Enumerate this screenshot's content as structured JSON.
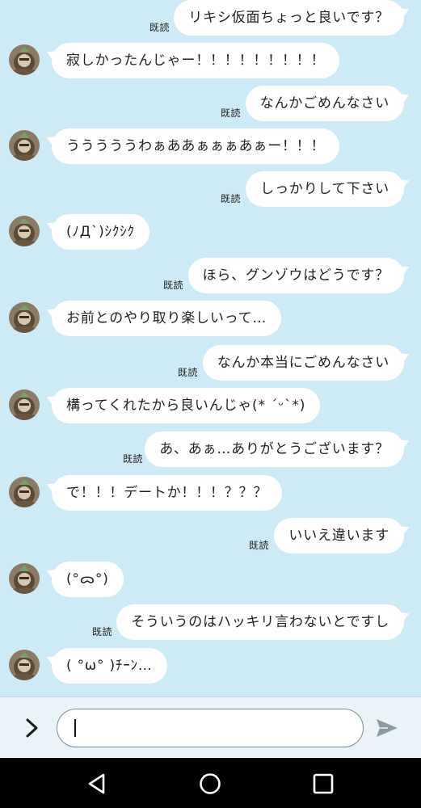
{
  "read_label": "既読",
  "messages": [
    {
      "side": "out",
      "text": "リキシ仮面ちょっと良いです？"
    },
    {
      "side": "in",
      "text": "寂しかったんじゃー！！！！！！！！！"
    },
    {
      "side": "out",
      "text": "なんかごめんなさい"
    },
    {
      "side": "in",
      "text": "うううううわぁああぁぁぁあぁー！！！"
    },
    {
      "side": "out",
      "text": "しっかりして下さい"
    },
    {
      "side": "in",
      "text": "(ﾉД`)ｼｸｼｸ"
    },
    {
      "side": "out",
      "text": "ほら、グンゾウはどうです？"
    },
    {
      "side": "in",
      "text": "お前とのやり取り楽しいって…"
    },
    {
      "side": "out",
      "text": "なんか本当にごめんなさい"
    },
    {
      "side": "in",
      "text": "構ってくれたから良いんじゃ(* ˊᵕˋ*)"
    },
    {
      "side": "out",
      "text": "あ、あぁ…ありがとうございます？"
    },
    {
      "side": "in",
      "text": "で！！！デートか！！！？？？"
    },
    {
      "side": "out",
      "text": "いいえ違います"
    },
    {
      "side": "in",
      "text": "(°ᯅ°)"
    },
    {
      "side": "out",
      "text": "そういうのはハッキリ言わないとですし"
    },
    {
      "side": "in",
      "text": "( °ω° )ﾁｰﾝ…"
    }
  ],
  "input": {
    "value": "",
    "placeholder": ""
  },
  "colors": {
    "chat_background": "#cdebf6",
    "bubble": "#ffffff",
    "input_bar": "#eaf3f7",
    "nav_bar": "#000000"
  },
  "icons": {
    "expand": "chevron-right-icon",
    "send": "send-icon",
    "back": "back-triangle-icon",
    "home": "home-circle-icon",
    "recents": "recents-square-icon"
  }
}
